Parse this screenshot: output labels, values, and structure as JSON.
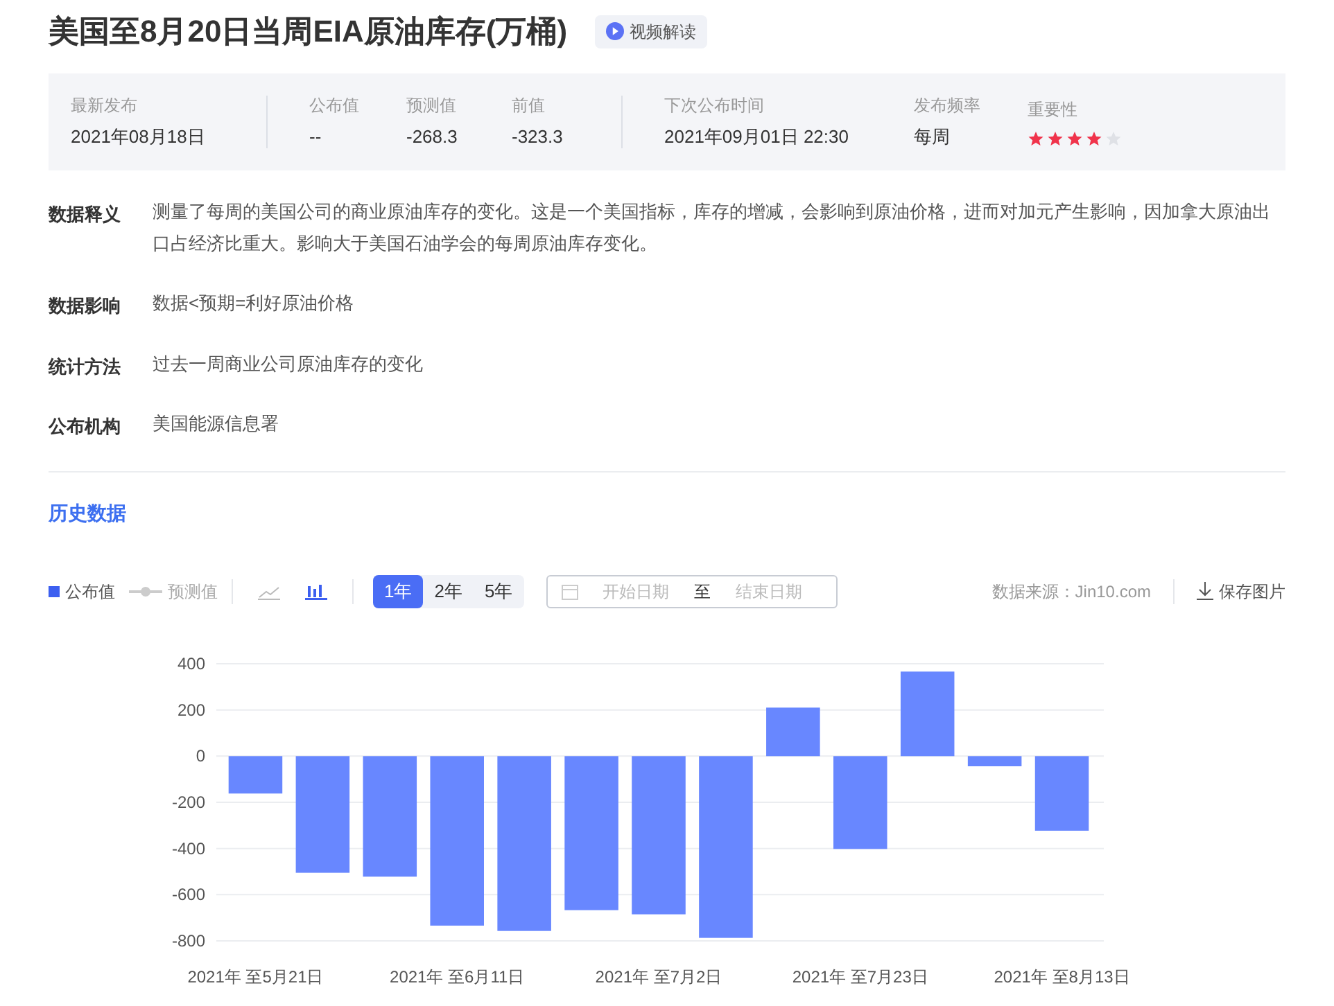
{
  "title": "美国至8月20日当周EIA原油库存(万桶)",
  "video_button": "视频解读",
  "summary": [
    {
      "kind": "text",
      "label": "最新发布",
      "value": "2021年08月18日"
    },
    {
      "kind": "text",
      "label": "公布值",
      "value": "--"
    },
    {
      "kind": "text",
      "label": "预测值",
      "value": "-268.3"
    },
    {
      "kind": "text",
      "label": "前值",
      "value": "-323.3"
    },
    {
      "kind": "text",
      "label": "下次公布时间",
      "value": "2021年09月01日 22:30"
    },
    {
      "kind": "text",
      "label": "发布频率",
      "value": "每周"
    },
    {
      "kind": "stars",
      "label": "重要性",
      "stars": 4
    }
  ],
  "details": [
    {
      "label": "数据释义",
      "value": "测量了每周的美国公司的商业原油库存的变化。这是一个美国指标，库存的增减，会影响到原油价格，进而对加元产生影响，因加拿大原油出口占经济比重大。影响大于美国石油学会的每周原油库存变化。"
    },
    {
      "label": "数据影响",
      "value": "数据<预期=利好原油价格"
    },
    {
      "label": "统计方法",
      "value": "过去一周商业公司原油库存的变化"
    },
    {
      "label": "公布机构",
      "value": "美国能源信息署"
    }
  ],
  "history_link": "历史数据",
  "toolbar": {
    "legend": [
      {
        "kind": "square",
        "label": "公布值",
        "on": true
      },
      {
        "kind": "line",
        "label": "预测值",
        "on": false
      }
    ],
    "chart_types": [
      {
        "kind": "line",
        "selected": false
      },
      {
        "kind": "bar",
        "selected": true
      }
    ],
    "ranges": [
      {
        "label": "1年",
        "selected": true
      },
      {
        "label": "2年",
        "selected": false
      },
      {
        "label": "5年",
        "selected": false
      }
    ],
    "date_start": {
      "placeholder": "开始日期"
    },
    "date_sep": "至",
    "date_end": {
      "placeholder": "结束日期"
    },
    "source": "数据来源：Jin10.com",
    "save": "保存图片"
  },
  "chart_data": {
    "type": "bar",
    "grid": true,
    "series": [
      {
        "color": "#6887ff",
        "values": [
          -162,
          -505,
          -522,
          -734,
          -757,
          -667,
          -685,
          -787,
          210,
          -402,
          366,
          -44,
          -323
        ]
      }
    ],
    "ylim": [
      -800,
      400
    ],
    "yticks": [
      400,
      200,
      0,
      -200,
      -400,
      -600,
      -800
    ],
    "categories": [
      "2021年 至5月21日",
      null,
      null,
      "2021年 至6月11日",
      null,
      null,
      "2021年 至7月2日",
      null,
      null,
      "2021年 至7月23日",
      null,
      null,
      "2021年 至8月13日"
    ]
  }
}
